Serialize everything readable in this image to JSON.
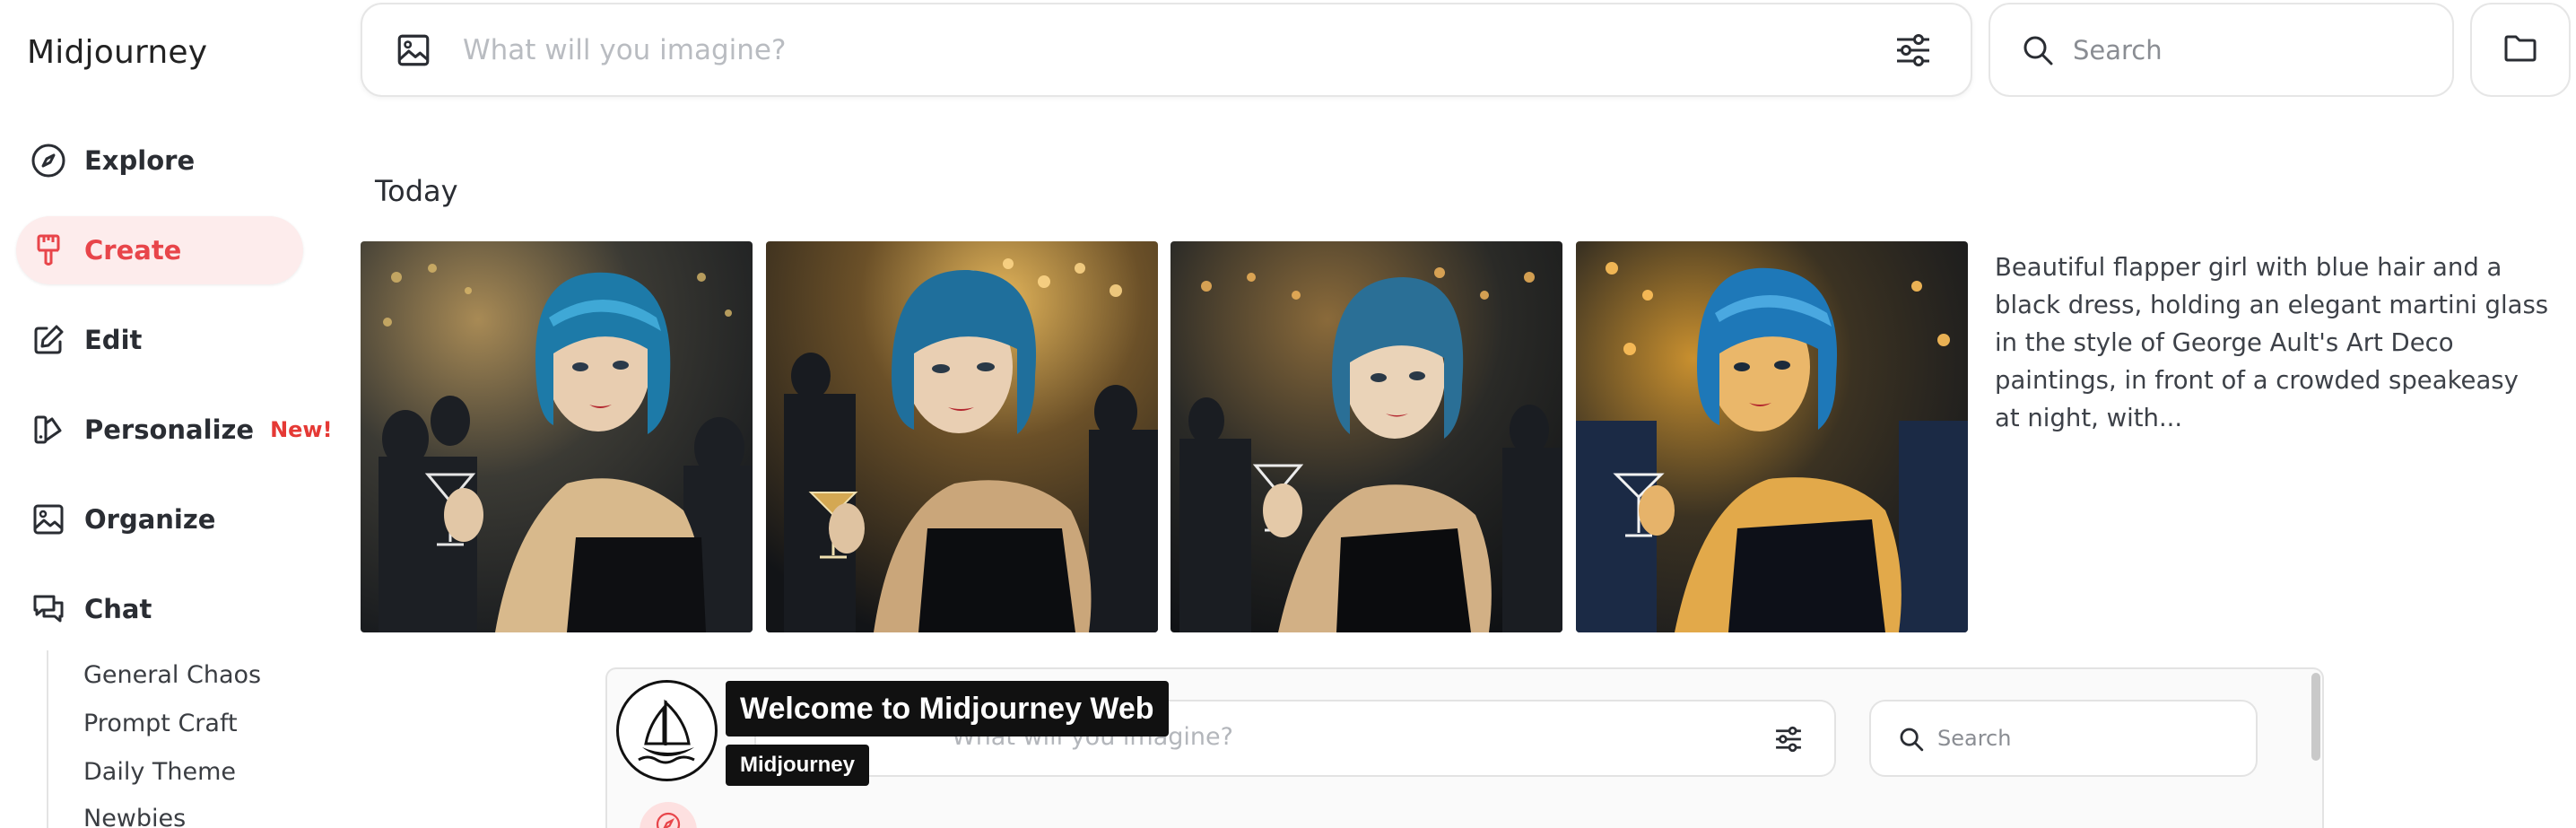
{
  "app": {
    "brand": "Midjourney"
  },
  "sidebar": {
    "items": [
      {
        "label": "Explore",
        "icon": "compass-icon"
      },
      {
        "label": "Create",
        "icon": "brush-icon",
        "active": true
      },
      {
        "label": "Edit",
        "icon": "edit-icon"
      },
      {
        "label": "Personalize",
        "icon": "palette-icon",
        "badge": "New!"
      },
      {
        "label": "Organize",
        "icon": "image-icon"
      },
      {
        "label": "Chat",
        "icon": "chat-icon"
      }
    ],
    "chat_rooms": [
      "General Chaos",
      "Prompt Craft",
      "Daily Theme",
      "Newbies"
    ]
  },
  "topbar": {
    "prompt_placeholder": "What will you imagine?",
    "search_placeholder": "Search"
  },
  "feed": {
    "section_title": "Today",
    "images": [
      {
        "alt": "Flapper girl with blue bob holding martini, variation 1"
      },
      {
        "alt": "Flapper girl with blue bob holding martini, variation 2"
      },
      {
        "alt": "Flapper girl with blue bob holding martini, variation 3"
      },
      {
        "alt": "Flapper girl with blue bob holding martini, variation 4"
      }
    ],
    "prompt_text": "Beautiful flapper girl with blue hair and a black dress, holding an elegant martini glass in the style of George Ault's Art Deco paintings, in front of a crowded speakeasy at night, with..."
  },
  "preview": {
    "prompt_placeholder": "What will you imagine?",
    "search_placeholder": "Search",
    "tooltip_title": "Welcome to Midjourney Web",
    "tooltip_subtitle": "Midjourney"
  },
  "colors": {
    "accent": "#e8454a",
    "active_bg": "#fdecec",
    "badge": "#e53935"
  }
}
